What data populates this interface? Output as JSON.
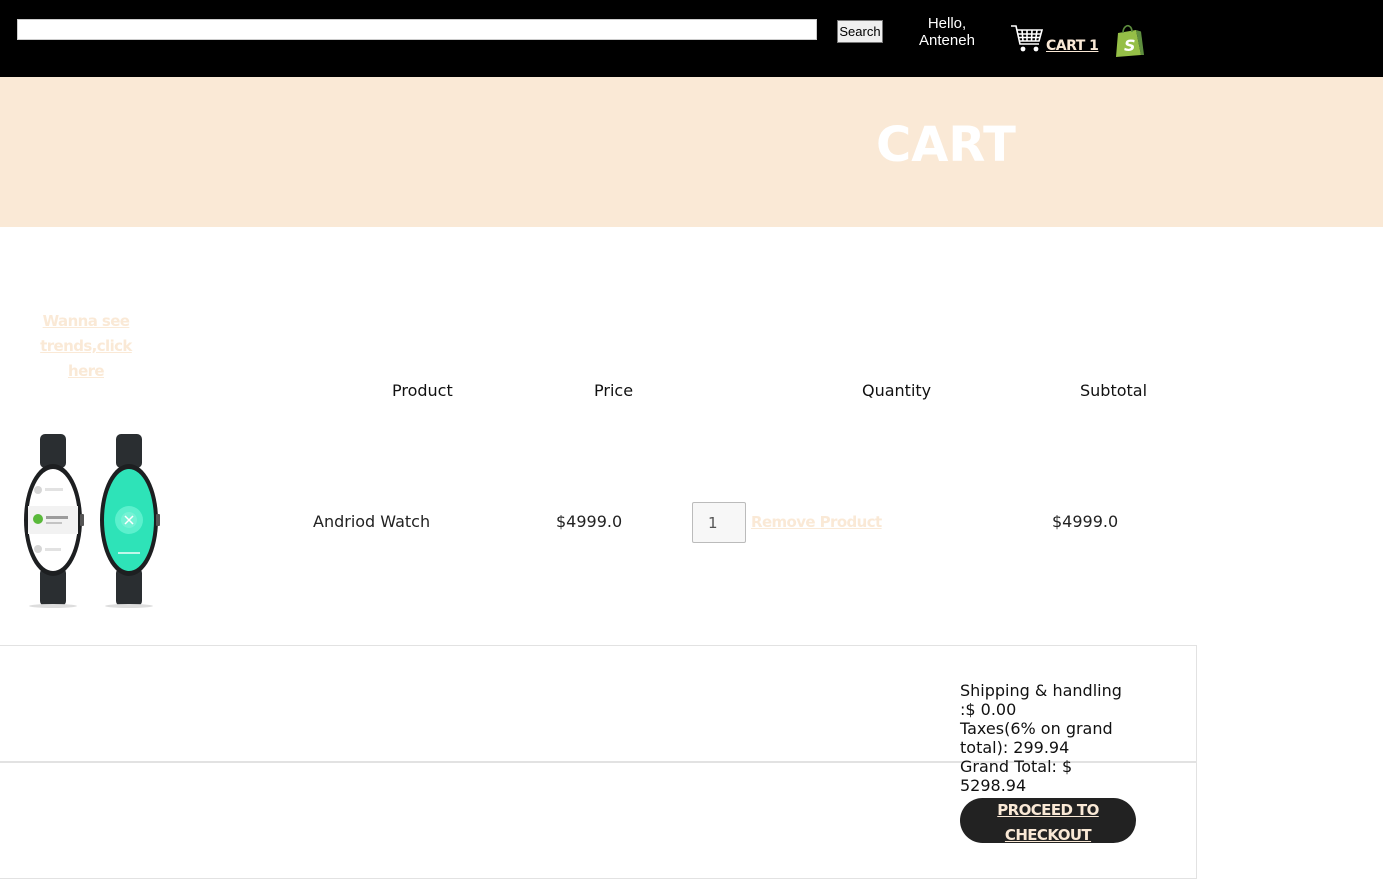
{
  "header": {
    "search": {
      "value": "",
      "placeholder": ""
    },
    "search_button": "Search",
    "greeting_line1": "Hello,",
    "greeting_line2": "Anteneh",
    "cart_label": "CART 1",
    "icons": [
      "cart-icon",
      "shopify-bag-icon"
    ]
  },
  "banner": {
    "title": "CART"
  },
  "trends_link": {
    "line1": "Wanna see trends,click",
    "line2": "here"
  },
  "table": {
    "headers": [
      "Product",
      "Price",
      "Quantity",
      "Subtotal"
    ],
    "rows": [
      {
        "image": "android-watch-image",
        "name": "Andriod Watch",
        "price": "$4999.0",
        "quantity": "1",
        "remove_label": "Remove Product",
        "subtotal": "$4999.0"
      }
    ]
  },
  "summary": {
    "shipping_line1": "Shipping & handling",
    "shipping_line2": ":$ 0.00",
    "taxes_line1": "Taxes(6% on grand",
    "taxes_line2": "total): 299.94",
    "grand_line1": "Grand Total: $",
    "grand_line2": "5298.94",
    "checkout_line1": "PROCEED TO",
    "checkout_line2": "CHECKOUT"
  },
  "colors": {
    "topbar": "#000000",
    "accent": "#fae9d6",
    "button_dark": "#222222",
    "shopify_green": "#95bf47"
  }
}
